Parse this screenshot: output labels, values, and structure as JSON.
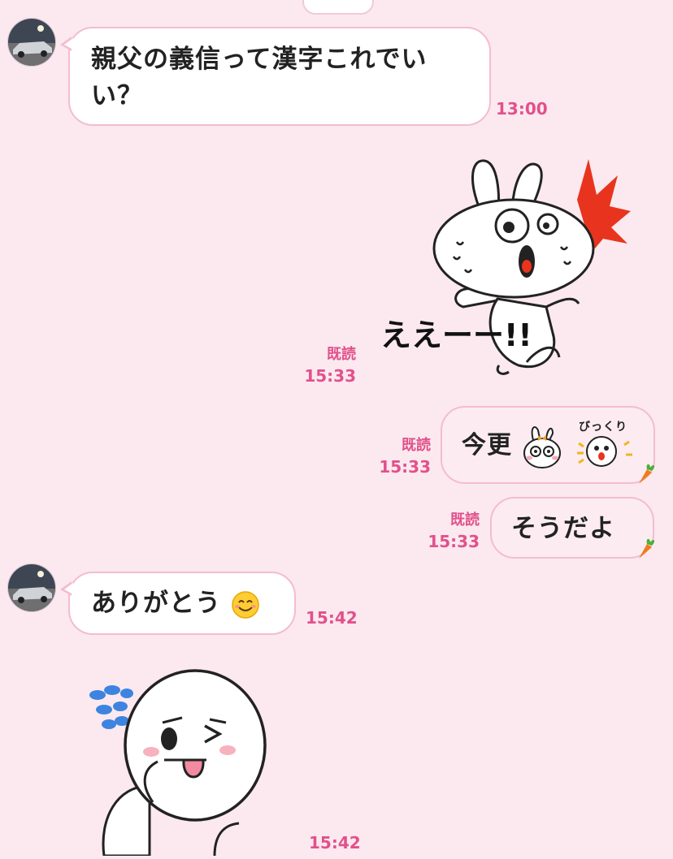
{
  "messages": [
    {
      "sender": "friend",
      "type": "text",
      "text": "親父の義信って漢字これでいい？",
      "time": "13:00"
    },
    {
      "sender": "me",
      "type": "sticker",
      "sticker": "rabbit-surprised-sticker",
      "sticker_text": "ええーー!!",
      "read": "既読",
      "time": "15:33"
    },
    {
      "sender": "me",
      "type": "text",
      "text": "今更",
      "emoji_text": "びっくり",
      "read": "既読",
      "time": "15:33"
    },
    {
      "sender": "me",
      "type": "text",
      "text": "そうだよ",
      "read": "既読",
      "time": "15:33"
    },
    {
      "sender": "friend",
      "type": "text",
      "text": "ありがとう",
      "emoji": "smiling-face",
      "time": "15:42"
    },
    {
      "sender": "friend",
      "type": "sticker",
      "sticker": "moon-tongue-out-sticker",
      "time": "15:42"
    }
  ],
  "colors": {
    "background": "#fbe9ef",
    "bubble_border": "#f4bcd0",
    "meta_text": "#e1518b",
    "sticker_burst": "#e8341e"
  }
}
